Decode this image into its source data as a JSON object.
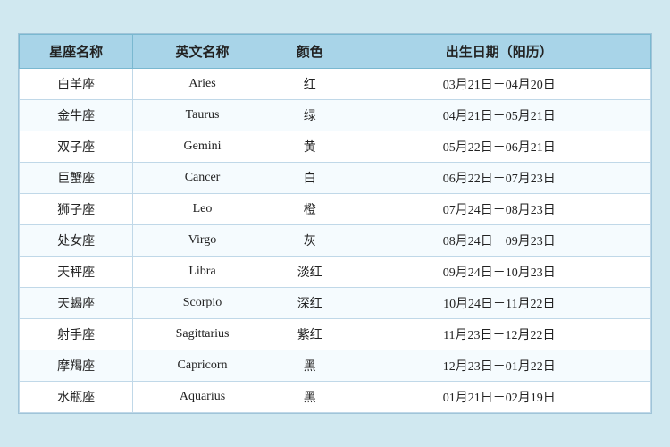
{
  "table": {
    "headers": {
      "chinese_name": "星座名称",
      "english_name": "英文名称",
      "color": "颜色",
      "birthdate": "出生日期（阳历）"
    },
    "rows": [
      {
        "cn": "白羊座",
        "en": "Aries",
        "color": "红",
        "date": "03月21日－04月20日"
      },
      {
        "cn": "金牛座",
        "en": "Taurus",
        "color": "绿",
        "date": "04月21日－05月21日"
      },
      {
        "cn": "双子座",
        "en": "Gemini",
        "color": "黄",
        "date": "05月22日－06月21日"
      },
      {
        "cn": "巨蟹座",
        "en": "Cancer",
        "color": "白",
        "date": "06月22日－07月23日"
      },
      {
        "cn": "狮子座",
        "en": "Leo",
        "color": "橙",
        "date": "07月24日－08月23日"
      },
      {
        "cn": "处女座",
        "en": "Virgo",
        "color": "灰",
        "date": "08月24日－09月23日"
      },
      {
        "cn": "天秤座",
        "en": "Libra",
        "color": "淡红",
        "date": "09月24日－10月23日"
      },
      {
        "cn": "天蝎座",
        "en": "Scorpio",
        "color": "深红",
        "date": "10月24日－11月22日"
      },
      {
        "cn": "射手座",
        "en": "Sagittarius",
        "color": "紫红",
        "date": "11月23日－12月22日"
      },
      {
        "cn": "摩羯座",
        "en": "Capricorn",
        "color": "黑",
        "date": "12月23日－01月22日"
      },
      {
        "cn": "水瓶座",
        "en": "Aquarius",
        "color": "黑",
        "date": "01月21日－02月19日"
      }
    ]
  }
}
